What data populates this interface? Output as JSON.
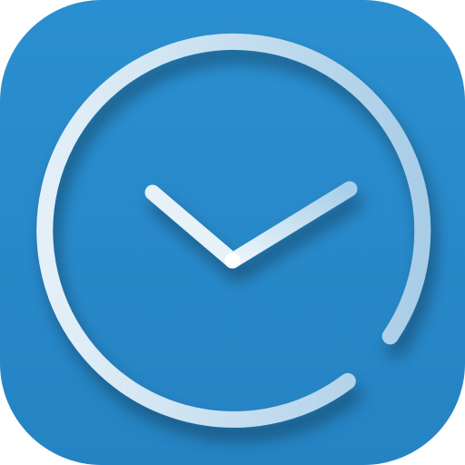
{
  "app_icon": {
    "icon": "clock-icon",
    "colors": {
      "background": "#2a8fd0",
      "background_edge": "#2583c3",
      "ring": "#d3e6f2",
      "hands": "#e6f1f8",
      "shadow": "#0d4c7a"
    },
    "clock": {
      "hour": 10,
      "minute": 10
    }
  }
}
